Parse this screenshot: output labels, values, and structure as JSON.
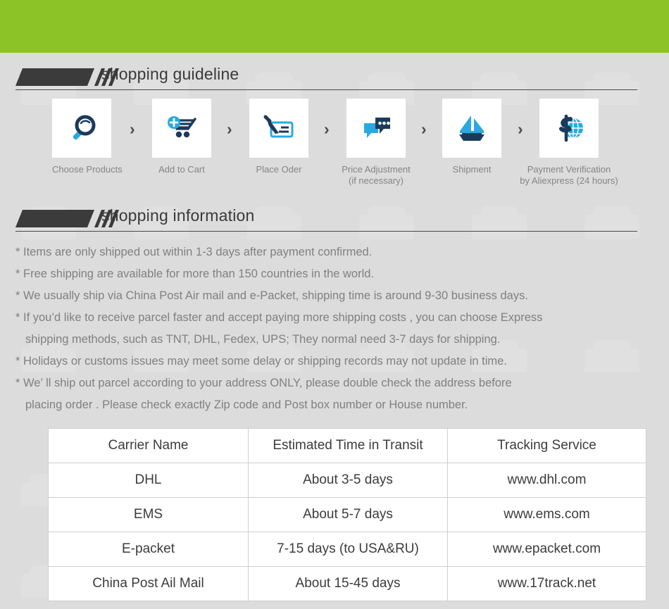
{
  "theme": {
    "green": "#8cc427",
    "background": "#dcdcdc",
    "heading_dark": "#3b3b3b",
    "body_text": "#808080",
    "icon_dark": "#1b3a5c",
    "icon_blue": "#29a9e1"
  },
  "sections": {
    "guideline": {
      "title": "shopping guideline",
      "steps": [
        {
          "label_line1": "Choose Products",
          "label_line2": "",
          "icon": "magnifier-icon"
        },
        {
          "label_line1": "Add to Cart",
          "label_line2": "",
          "icon": "cart-plus-icon"
        },
        {
          "label_line1": "Place Oder",
          "label_line2": "",
          "icon": "pen-card-icon"
        },
        {
          "label_line1": "Price Adjustment",
          "label_line2": "(if necessary)",
          "icon": "chat-bubbles-icon"
        },
        {
          "label_line1": "Shipment",
          "label_line2": "",
          "icon": "sailboat-icon"
        },
        {
          "label_line1": "Payment Verification",
          "label_line2": "by  Aliexpress (24 hours)",
          "icon": "dollar-globe-icon"
        }
      ],
      "separator": "›"
    },
    "information": {
      "title": "shopping information",
      "bullets": [
        "* Items are only shipped out within 1-3 days after payment confirmed.",
        "* Free shipping are available for more than 150 countries in the world.",
        "* We usually ship via China Post Air mail and e-Packet, shipping time is around 9-30 business days.",
        "* If you’d like to receive parcel faster and accept paying more shipping costs , you can choose Express",
        "shipping methods, such as TNT, DHL, Fedex, UPS; They normal need 3-7 days for shipping.",
        "* Holidays or customs issues may meet some delay or shipping records may not update in time.",
        "* We’ ll ship out parcel according to your address ONLY, please double check the address before",
        "placing order . Please check exactly Zip code and Post box number or House number."
      ]
    }
  },
  "carrier_table": {
    "headers": [
      "Carrier Name",
      "Estimated Time in Transit",
      "Tracking Service"
    ],
    "rows": [
      [
        "DHL",
        "About 3-5 days",
        "www.dhl.com"
      ],
      [
        "EMS",
        "About 5-7 days",
        "www.ems.com"
      ],
      [
        "E-packet",
        "7-15 days (to USA&RU)",
        "www.epacket.com"
      ],
      [
        "China Post Ail Mail",
        "About 15-45 days",
        "www.17track.net"
      ]
    ]
  }
}
